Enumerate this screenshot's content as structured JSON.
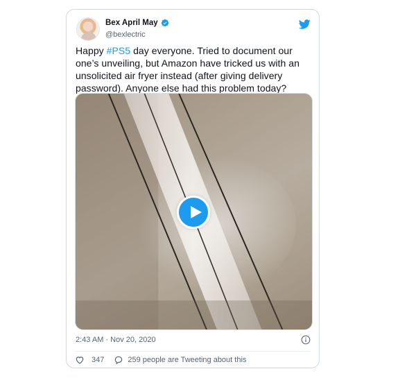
{
  "tweet": {
    "display_name": "Bex April May",
    "handle": "@bexlectric",
    "text_before_hashtag": "Happy ",
    "hashtag": "#PS5",
    "text_after_hashtag": " day everyone. Tried to document our one’s unveiling, but Amazon have tricked us with an unsolicited air fryer instead (after giving delivery password). Anyone else had this problem today?",
    "timestamp": "2:43 AM · Nov 20, 2020",
    "like_count": "347",
    "replies_text": "259 people are Tweeting about this"
  },
  "icons": {
    "verified": "verified-badge-icon",
    "brand": "twitter-bird-icon",
    "play": "play-icon",
    "info": "info-icon",
    "like": "heart-icon",
    "reply": "speech-bubble-icon"
  },
  "colors": {
    "accent": "#1d9bf0",
    "text": "#0f1419",
    "secondary": "#536471",
    "border": "#cfd9de"
  }
}
